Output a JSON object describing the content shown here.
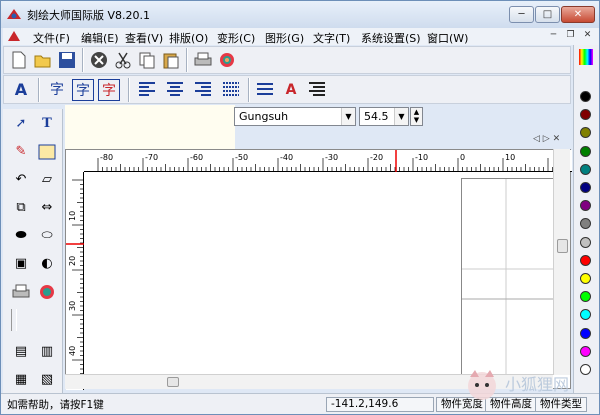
{
  "title": "刻绘大师国际版 V8.20.1",
  "window_controls": {
    "minimize": "─",
    "maximize": "□",
    "close": "✕"
  },
  "menu": [
    "文件(F)",
    "编辑(E)",
    "查看(V)",
    "排版(O)",
    "变形(C)",
    "图形(G)",
    "文字(T)",
    "系统设置(S)",
    "窗口(W)"
  ],
  "mdi_controls": {
    "minimize": "─",
    "restore": "❐",
    "close": "✕"
  },
  "toolbar_text": {
    "char1": "字",
    "char2": "字",
    "char3": "字",
    "char_a": "A"
  },
  "font": {
    "name": "Gungsuh",
    "size": "54.5"
  },
  "tab_nav": "◁ ▷ ✕",
  "ruler_h_labels": [
    "-80",
    "-70",
    "-60",
    "-50",
    "-40",
    "-30",
    "-20",
    "-10",
    "0",
    "10"
  ],
  "ruler_v_labels": [
    "10",
    "20",
    "30",
    "40"
  ],
  "palette_colors": [
    "#000000",
    "#800000",
    "#808000",
    "#008000",
    "#008080",
    "#000080",
    "#800080",
    "#808080",
    "#c0c0c0",
    "#ff0000",
    "#ffff00",
    "#00ff00",
    "#00ffff",
    "#0000ff",
    "#ff00ff",
    "#ffffff"
  ],
  "status": {
    "help": "如需帮助，请按F1键",
    "coords": "-141.2,149.6",
    "width_label": "物件宽度",
    "height_label": "物件高度",
    "type_label": "物件类型"
  },
  "watermark_text": "小狐狸网"
}
